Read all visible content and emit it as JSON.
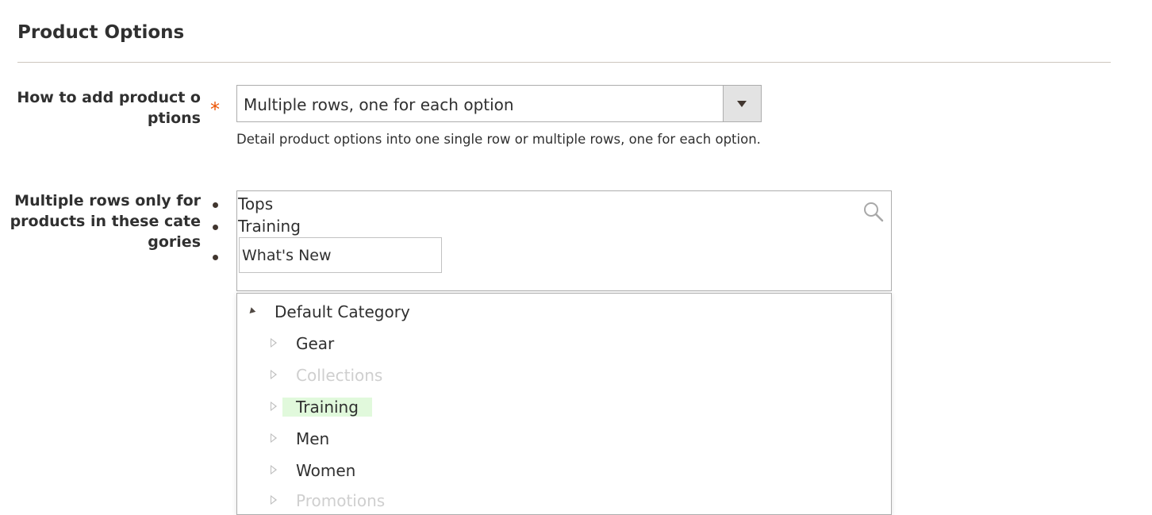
{
  "section": {
    "title": "Product Options"
  },
  "option_mode": {
    "label_line1": "How to add product o",
    "label_line2": "ptions",
    "required_mark": "*",
    "selected_value": "Multiple rows, one for each option",
    "note": "Detail product options into one single row or multiple rows, one for each option."
  },
  "categories_field": {
    "label_line1": "Multiple rows only for",
    "label_line2": "products in these cate",
    "label_line3": "gories",
    "selected": [
      "Tops",
      "Training"
    ],
    "search_value": "What's New",
    "icon": "search-icon"
  },
  "tree": {
    "root": "Default Category",
    "children": [
      {
        "label": "Gear",
        "state": "normal"
      },
      {
        "label": "Collections",
        "state": "disabled"
      },
      {
        "label": "Training",
        "state": "highlighted"
      },
      {
        "label": "Men",
        "state": "normal"
      },
      {
        "label": "Women",
        "state": "normal"
      },
      {
        "label": "Promotions",
        "state": "disabled"
      }
    ]
  },
  "colors": {
    "required": "#eb5202",
    "highlight": "#e1f9dc",
    "disabled_text": "#cfcfcf",
    "border": "#adadad"
  }
}
